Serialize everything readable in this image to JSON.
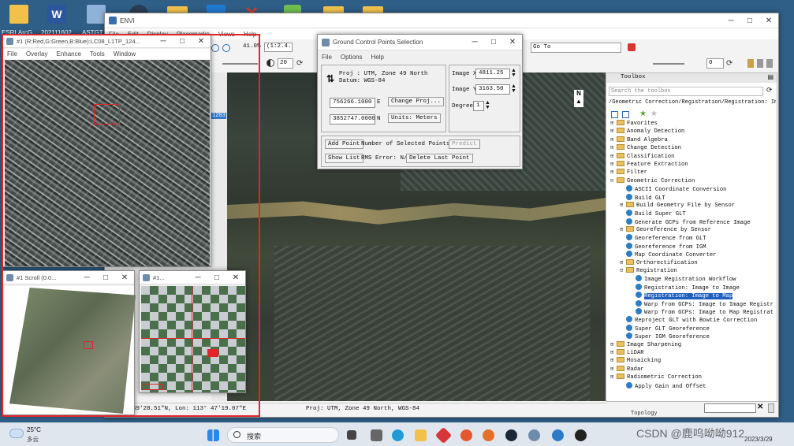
{
  "desktop": {
    "icons": [
      {
        "label": "ESRI.ArcG..."
      },
      {
        "label": "202111602"
      },
      {
        "label": "ASTGT"
      },
      {
        "label": ""
      },
      {
        "label": ""
      },
      {
        "label": ""
      },
      {
        "label": ""
      },
      {
        "label": ""
      },
      {
        "label": ""
      },
      {
        "label": ""
      }
    ]
  },
  "envi": {
    "title": "ENVI",
    "menu": [
      "File",
      "Edit",
      "Display",
      "Placemarks",
      "Views",
      "Help"
    ],
    "zoom_value": "41.0%",
    "zoom_ratio": "(1:2.4...",
    "brightness": "20",
    "goto_label": "Go To",
    "rotation": "0",
    "status_left": "49'28.51\"N, Lon: 113° 47'19.07\"E",
    "status_right": "Proj: UTM, Zone 49 North, WGS-84",
    "side_value": "1203"
  },
  "image_window": {
    "title": "#1 (R:Red,G:Green,B:Blue):LC08_L1TP_124...",
    "menu": [
      "File",
      "Overlay",
      "Enhance",
      "Tools",
      "Window"
    ]
  },
  "scroll_window": {
    "title": "#1 Scroll (0.0..."
  },
  "zoom_window": {
    "title": "#1..."
  },
  "gcp": {
    "title": "Ground Control Points Selection",
    "menu": [
      "File",
      "Options",
      "Help"
    ],
    "proj_line1": "Proj : UTM, Zone 49 North",
    "proj_line2": "Datum: WGS-84",
    "easting": "756266.1000",
    "easting_unit": "E",
    "northing": "3852747.0000",
    "northing_unit": "N",
    "change_proj": "Change Proj...",
    "units": "Units: Meters",
    "image_x_label": "Image X",
    "image_x": "4811.25",
    "image_y_label": "Image Y",
    "image_y": "3163.50",
    "degree_label": "Degree",
    "degree": "1",
    "add_point": "Add Point",
    "num_selected": "Number of Selected Points: 1",
    "predict": "Predict",
    "show_list": "Show List",
    "rms_error": "RMS Error: N/A",
    "delete_last": "Delete Last Point"
  },
  "toolbox": {
    "title": "Toolbox",
    "search_placeholder": "Search the toolbox",
    "path": "/Geometric Correction/Registration/Registration: Imag",
    "items": [
      {
        "label": "Favorites",
        "kind": "folder",
        "indent": 0
      },
      {
        "label": "Anomaly Detection",
        "kind": "folder",
        "indent": 0
      },
      {
        "label": "Band Algebra",
        "kind": "folder",
        "indent": 0
      },
      {
        "label": "Change Detection",
        "kind": "folder",
        "indent": 0
      },
      {
        "label": "Classification",
        "kind": "folder",
        "indent": 0
      },
      {
        "label": "Feature Extraction",
        "kind": "folder",
        "indent": 0
      },
      {
        "label": "Filter",
        "kind": "folder",
        "indent": 0
      },
      {
        "label": "Geometric Correction",
        "kind": "folder",
        "indent": 0,
        "open": true
      },
      {
        "label": "ASCII Coordinate Conversion",
        "kind": "tool",
        "indent": 1
      },
      {
        "label": "Build GLT",
        "kind": "tool",
        "indent": 1
      },
      {
        "label": "Build Geometry File by Sensor",
        "kind": "folder",
        "indent": 1
      },
      {
        "label": "Build Super GLT",
        "kind": "tool",
        "indent": 1
      },
      {
        "label": "Generate GCPs from Reference Image",
        "kind": "tool",
        "indent": 1
      },
      {
        "label": "Georeference by Sensor",
        "kind": "folder",
        "indent": 1
      },
      {
        "label": "Georeference from GLT",
        "kind": "tool",
        "indent": 1
      },
      {
        "label": "Georeference from IGM",
        "kind": "tool",
        "indent": 1
      },
      {
        "label": "Map Coordinate Converter",
        "kind": "tool",
        "indent": 1
      },
      {
        "label": "Orthorectification",
        "kind": "folder",
        "indent": 1
      },
      {
        "label": "Registration",
        "kind": "folder",
        "indent": 1,
        "open": true
      },
      {
        "label": "Image Registration Workflow",
        "kind": "tool",
        "indent": 2
      },
      {
        "label": "Registration: Image to Image",
        "kind": "tool",
        "indent": 2
      },
      {
        "label": "Registration: Image to Map",
        "kind": "tool",
        "indent": 2,
        "selected": true
      },
      {
        "label": "Warp from GCPs: Image to Image Registr",
        "kind": "tool",
        "indent": 2
      },
      {
        "label": "Warp from GCPs: Image to Map Registrat",
        "kind": "tool",
        "indent": 2
      },
      {
        "label": "Reproject GLT with Bowtie Correction",
        "kind": "tool",
        "indent": 1
      },
      {
        "label": "Super GLT Georeference",
        "kind": "tool",
        "indent": 1
      },
      {
        "label": "Super IGM Georeference",
        "kind": "tool",
        "indent": 1
      },
      {
        "label": "Image Sharpening",
        "kind": "folder",
        "indent": 0
      },
      {
        "label": "LiDAR",
        "kind": "folder",
        "indent": 0
      },
      {
        "label": "Mosaicking",
        "kind": "folder",
        "indent": 0
      },
      {
        "label": "Radar",
        "kind": "folder",
        "indent": 0
      },
      {
        "label": "Radiometric Correction",
        "kind": "folder",
        "indent": 0
      },
      {
        "label": "Apply Gain and Offset",
        "kind": "tool",
        "indent": 1
      }
    ],
    "bottom_item": "Topology"
  },
  "taskbar": {
    "weather_temp": "25°C",
    "weather_desc": "多云",
    "search_label": "搜索",
    "time": "",
    "date": "2023/3/29",
    "watermark": "CSDN @鹿呜呦呦912"
  },
  "colors": {
    "selected": "#1f5fbf",
    "annotation_red": "#e0262b"
  }
}
